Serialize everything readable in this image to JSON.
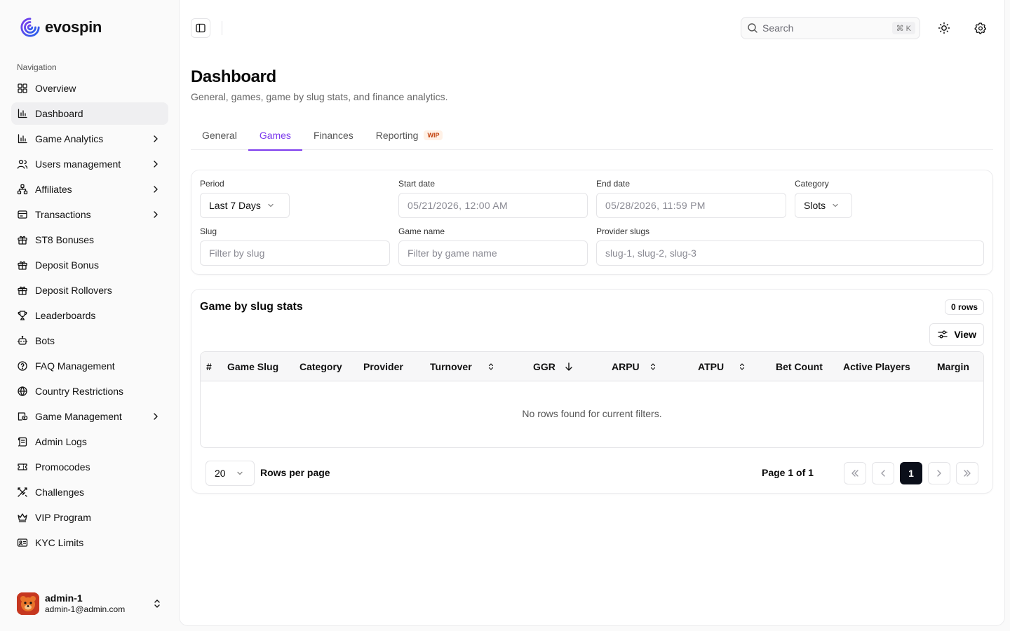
{
  "brand": {
    "name": "evospin"
  },
  "sidebar": {
    "heading": "Navigation",
    "items": [
      {
        "label": "Overview",
        "icon": "layout-grid-icon",
        "has_chevron": false
      },
      {
        "label": "Dashboard",
        "icon": "bar-chart-icon",
        "has_chevron": false,
        "active": true
      },
      {
        "label": "Game Analytics",
        "icon": "bar-chart-icon",
        "has_chevron": true
      },
      {
        "label": "Users management",
        "icon": "users-icon",
        "has_chevron": true
      },
      {
        "label": "Affiliates",
        "icon": "network-icon",
        "has_chevron": true
      },
      {
        "label": "Transactions",
        "icon": "wallet-icon",
        "has_chevron": true
      },
      {
        "label": "ST8 Bonuses",
        "icon": "gift-icon",
        "has_chevron": false
      },
      {
        "label": "Deposit Bonus",
        "icon": "gift-icon",
        "has_chevron": false
      },
      {
        "label": "Deposit Rollovers",
        "icon": "gift-icon",
        "has_chevron": false
      },
      {
        "label": "Leaderboards",
        "icon": "trophy-icon",
        "has_chevron": false
      },
      {
        "label": "Bots",
        "icon": "bot-icon",
        "has_chevron": false
      },
      {
        "label": "FAQ Management",
        "icon": "help-circle-icon",
        "has_chevron": false
      },
      {
        "label": "Country Restrictions",
        "icon": "globe-icon",
        "has_chevron": false
      },
      {
        "label": "Game Management",
        "icon": "gamepad-icon",
        "has_chevron": true
      },
      {
        "label": "Admin Logs",
        "icon": "scroll-icon",
        "has_chevron": false
      },
      {
        "label": "Promocodes",
        "icon": "ticket-icon",
        "has_chevron": false
      },
      {
        "label": "Challenges",
        "icon": "swords-icon",
        "has_chevron": false
      },
      {
        "label": "VIP Program",
        "icon": "crown-icon",
        "has_chevron": false
      },
      {
        "label": "KYC Limits",
        "icon": "id-card-icon",
        "has_chevron": false
      }
    ]
  },
  "user": {
    "name": "admin-1",
    "email": "admin-1@admin.com"
  },
  "topbar": {
    "search_placeholder": "Search",
    "shortcut": "⌘ K"
  },
  "page": {
    "title": "Dashboard",
    "subtitle": "General, games, game by slug stats, and finance analytics."
  },
  "tabs": [
    {
      "label": "General",
      "active": false
    },
    {
      "label": "Games",
      "active": true
    },
    {
      "label": "Finances",
      "active": false
    },
    {
      "label": "Reporting",
      "active": false,
      "badge": "WIP"
    }
  ],
  "filters": {
    "period": {
      "label": "Period",
      "value": "Last 7 Days"
    },
    "start_date": {
      "label": "Start date",
      "value": "05/21/2026, 12:00 AM"
    },
    "end_date": {
      "label": "End date",
      "value": "05/28/2026, 11:59 PM"
    },
    "category": {
      "label": "Category",
      "value": "Slots"
    },
    "slug": {
      "label": "Slug",
      "placeholder": "Filter by slug"
    },
    "game_name": {
      "label": "Game name",
      "placeholder": "Filter by game name"
    },
    "provider_slugs": {
      "label": "Provider slugs",
      "placeholder": "slug-1, slug-2, slug-3"
    }
  },
  "stats": {
    "title": "Game by slug stats",
    "row_count": "0 rows",
    "view_label": "View",
    "columns": [
      {
        "label": "#",
        "sort": "none"
      },
      {
        "label": "Game Slug",
        "sort": "none"
      },
      {
        "label": "Category",
        "sort": "none"
      },
      {
        "label": "Provider",
        "sort": "none"
      },
      {
        "label": "Turnover",
        "sort": "sortable"
      },
      {
        "label": "GGR",
        "sort": "desc"
      },
      {
        "label": "ARPU",
        "sort": "sortable"
      },
      {
        "label": "ATPU",
        "sort": "sortable"
      },
      {
        "label": "Bet Count",
        "sort": "none"
      },
      {
        "label": "Active Players",
        "sort": "none"
      },
      {
        "label": "Margin",
        "sort": "none"
      }
    ],
    "empty_message": "No rows found for current filters."
  },
  "pagination": {
    "rows_per_page_value": "20",
    "rows_per_page_label": "Rows per page",
    "page_info": "Page 1 of 1",
    "current_page": "1"
  },
  "colors": {
    "accent": "#7c3aed",
    "wip": "#c2410c",
    "current_page_bg": "#0b0f1a"
  }
}
